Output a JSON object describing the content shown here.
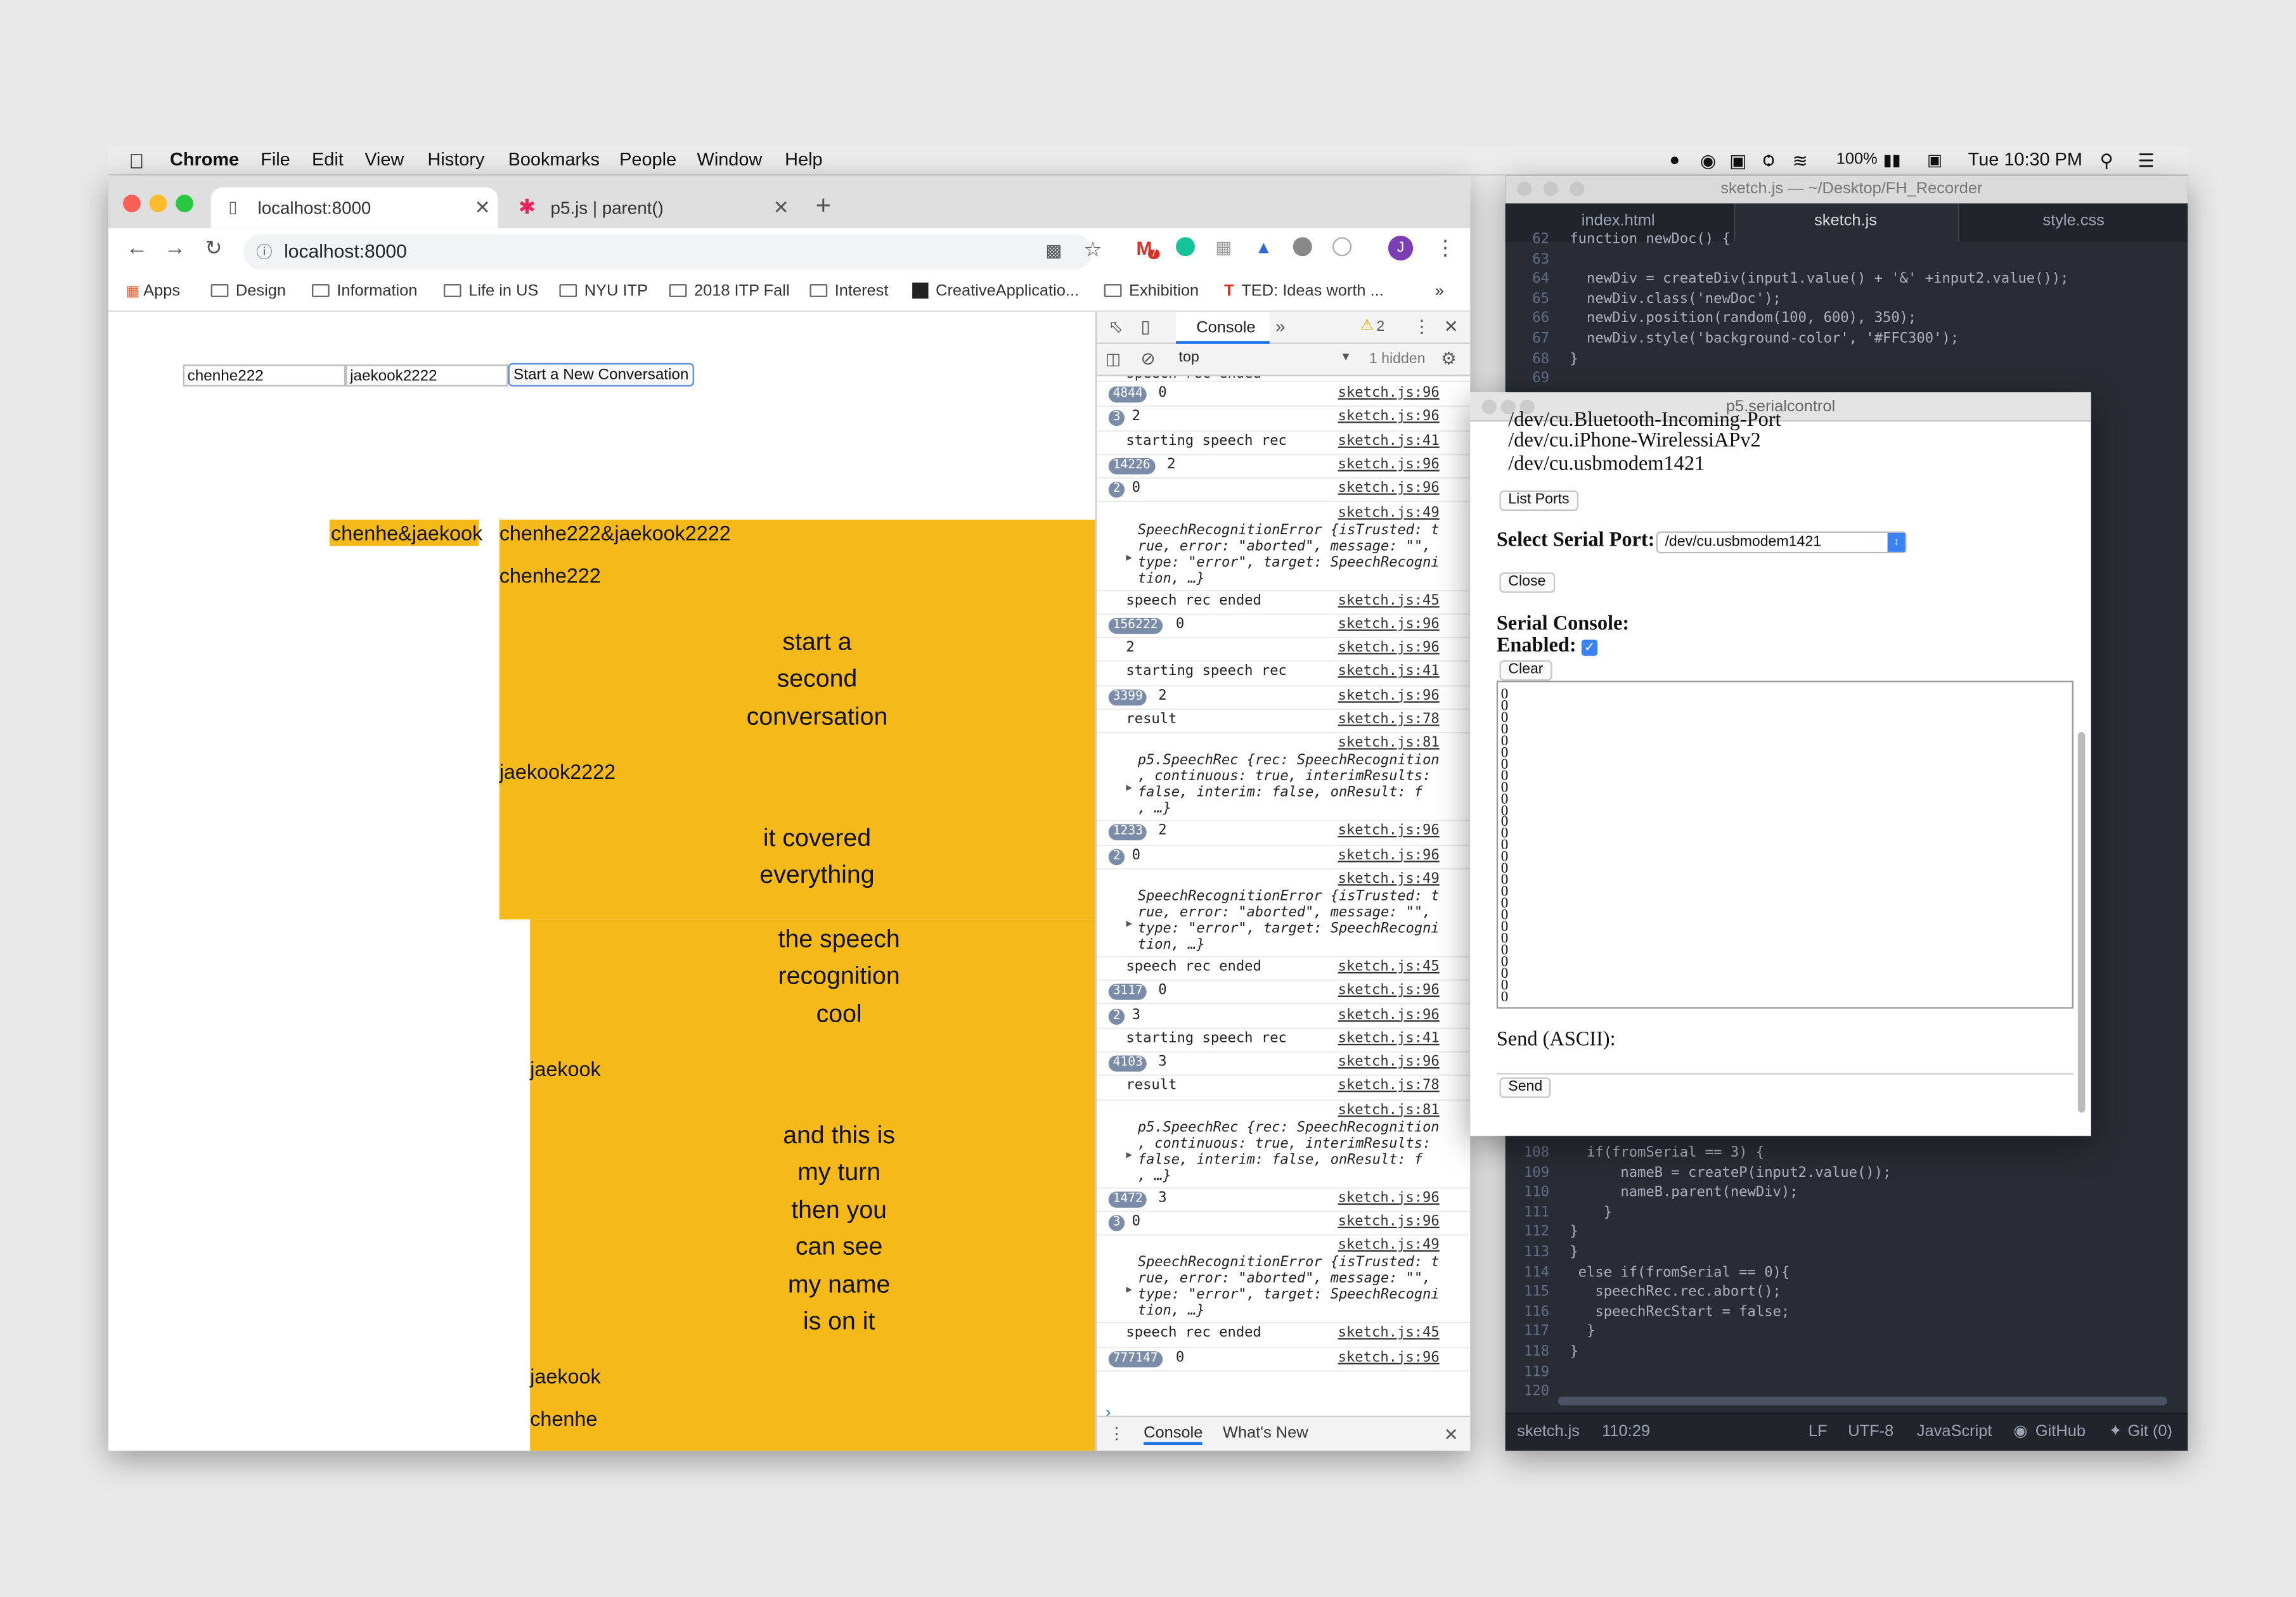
{
  "menubar": {
    "app": "Chrome",
    "items": [
      "File",
      "Edit",
      "View",
      "History",
      "Bookmarks",
      "People",
      "Window",
      "Help"
    ],
    "battery": "100%",
    "clock": "Tue 10:30 PM"
  },
  "browser": {
    "tabs": [
      {
        "title": "localhost:8000"
      },
      {
        "title": "p5.js | parent()"
      }
    ],
    "url": "localhost:8000",
    "bookmarks": [
      "Apps",
      "Design",
      "Information",
      "Life in US",
      "NYU ITP",
      "2018 ITP Fall",
      "Interest",
      "CreativeApplicatio...",
      "Exhibition",
      "TED: Ideas worth ..."
    ],
    "gmail_badge": "7"
  },
  "page": {
    "input1": "chenhe222",
    "input2": "jaekook2222",
    "start_button": "Start a New Conversation",
    "label_small": "chenhe&jaekook",
    "label_big": "chenhe222&jaekook2222",
    "speaker1": "chenhe222",
    "speech1": "start a\nsecond\nconversation",
    "speaker2": "jaekook2222",
    "speech2": "it covered\neverything",
    "speech3": "the speech\nrecognition\ncool",
    "speaker3": "jaekook",
    "speech4": "and this is\nmy turn\nthen you\ncan see\nmy name\nis on it",
    "speaker4": "jaekook",
    "speaker5": "chenhe",
    "colors": {
      "accent": "#FFC300"
    }
  },
  "devtools": {
    "panel": "Console",
    "warnings": "2",
    "context": "top",
    "hidden": "1 hidden",
    "partial_top": "speech rec ended",
    "logs": [
      {
        "count": "4844",
        "value": "0",
        "src": "sketch.js:96"
      },
      {
        "count": "3",
        "value": "2",
        "src": "sketch.js:96"
      },
      {
        "count": "",
        "value": "starting speech rec",
        "src": "sketch.js:41"
      },
      {
        "count": "14226",
        "value": "2",
        "src": "sketch.js:96"
      },
      {
        "count": "2",
        "value": "0",
        "src": "sketch.js:96"
      },
      {
        "count": "",
        "value": "SpeechRecognitionError {isTrusted: t\nrue, error: \"aborted\", message: \"\",\ntype: \"error\", target: SpeechRecogni\ntion, …}",
        "src": "sketch.js:49",
        "obj": true
      },
      {
        "count": "",
        "value": "speech rec ended",
        "src": "sketch.js:45"
      },
      {
        "count": "156222",
        "value": "0",
        "src": "sketch.js:96"
      },
      {
        "count": "",
        "value": "2",
        "src": "sketch.js:96"
      },
      {
        "count": "",
        "value": "starting speech rec",
        "src": "sketch.js:41"
      },
      {
        "count": "3399",
        "value": "2",
        "src": "sketch.js:96"
      },
      {
        "count": "",
        "value": "result",
        "src": "sketch.js:78"
      },
      {
        "count": "",
        "value": "p5.SpeechRec {rec: SpeechRecognition\n, continuous: true, interimResults:\nfalse, interim: false, onResult: f\n, …}",
        "src": "sketch.js:81",
        "obj": true
      },
      {
        "count": "1233",
        "value": "2",
        "src": "sketch.js:96"
      },
      {
        "count": "2",
        "value": "0",
        "src": "sketch.js:96"
      },
      {
        "count": "",
        "value": "SpeechRecognitionError {isTrusted: t\nrue, error: \"aborted\", message: \"\",\ntype: \"error\", target: SpeechRecogni\ntion, …}",
        "src": "sketch.js:49",
        "obj": true
      },
      {
        "count": "",
        "value": "speech rec ended",
        "src": "sketch.js:45"
      },
      {
        "count": "3117",
        "value": "0",
        "src": "sketch.js:96"
      },
      {
        "count": "2",
        "value": "3",
        "src": "sketch.js:96"
      },
      {
        "count": "",
        "value": "starting speech rec",
        "src": "sketch.js:41"
      },
      {
        "count": "4103",
        "value": "3",
        "src": "sketch.js:96"
      },
      {
        "count": "",
        "value": "result",
        "src": "sketch.js:78"
      },
      {
        "count": "",
        "value": "p5.SpeechRec {rec: SpeechRecognition\n, continuous: true, interimResults:\nfalse, interim: false, onResult: f\n, …}",
        "src": "sketch.js:81",
        "obj": true
      },
      {
        "count": "1472",
        "value": "3",
        "src": "sketch.js:96"
      },
      {
        "count": "3",
        "value": "0",
        "src": "sketch.js:96"
      },
      {
        "count": "",
        "value": "SpeechRecognitionError {isTrusted: t\nrue, error: \"aborted\", message: \"\",\ntype: \"error\", target: SpeechRecogni\ntion, …}",
        "src": "sketch.js:49",
        "obj": true
      },
      {
        "count": "",
        "value": "speech rec ended",
        "src": "sketch.js:45"
      },
      {
        "count": "777147",
        "value": "0",
        "src": "sketch.js:96"
      }
    ],
    "drawer_tabs": [
      "Console",
      "What's New"
    ]
  },
  "editor": {
    "title": "sketch.js — ~/Desktop/FH_Recorder",
    "tabs": [
      "index.html",
      "sketch.js",
      "style.css"
    ],
    "code_top": [
      {
        "n": "62",
        "t": "function newDoc() {"
      },
      {
        "n": "63",
        "t": ""
      },
      {
        "n": "64",
        "t": "  newDiv = createDiv(input1.value() + '&' +input2.value());"
      },
      {
        "n": "65",
        "t": "  newDiv.class('newDoc');"
      },
      {
        "n": "66",
        "t": "  newDiv.position(random(100, 600), 350);"
      },
      {
        "n": "67",
        "t": "  newDiv.style('background-color', '#FFC300');"
      },
      {
        "n": "68",
        "t": "}"
      },
      {
        "n": "69",
        "t": ""
      }
    ],
    "code_bottom": [
      {
        "n": "108",
        "t": "  if(fromSerial == 3) {"
      },
      {
        "n": "109",
        "t": "      nameB = createP(input2.value());"
      },
      {
        "n": "110",
        "t": "      nameB.parent(newDiv);"
      },
      {
        "n": "111",
        "t": "    }"
      },
      {
        "n": "112",
        "t": "}"
      },
      {
        "n": "113",
        "t": "}"
      },
      {
        "n": "114",
        "t": " else if(fromSerial == 0){"
      },
      {
        "n": "115",
        "t": "   speechRec.rec.abort();"
      },
      {
        "n": "116",
        "t": "   speechRecStart = false;"
      },
      {
        "n": "117",
        "t": "  }"
      },
      {
        "n": "118",
        "t": "}"
      },
      {
        "n": "119",
        "t": ""
      },
      {
        "n": "120",
        "t": ""
      }
    ],
    "status": {
      "file": "sketch.js",
      "cursor": "110:29",
      "eol": "LF",
      "encoding": "UTF-8",
      "grammar": "JavaScript",
      "github": "GitHub",
      "git": "Git (0)"
    }
  },
  "serial": {
    "title": "p5.serialcontrol",
    "ports": [
      "/dev/cu.Bluetooth-Incoming-Port",
      "/dev/cu.iPhone-WirelessiAPv2",
      "/dev/cu.usbmodem1421"
    ],
    "list_ports": "List Ports",
    "select_label": "Select Serial Port:",
    "selected_port": "/dev/cu.usbmodem1421",
    "close": "Close",
    "console_label": "Serial Console:",
    "enabled_label": "Enabled:",
    "clear": "Clear",
    "console_text": "0\n0\n0\n0\n0\n0\n0\n0\n0\n0\n0\n0\n0\n0\n0\n0\n0\n0\n0\n0\n0\n0\n0\n0\n0\n0\n0",
    "send_label": "Send (ASCII):",
    "send": "Send"
  }
}
